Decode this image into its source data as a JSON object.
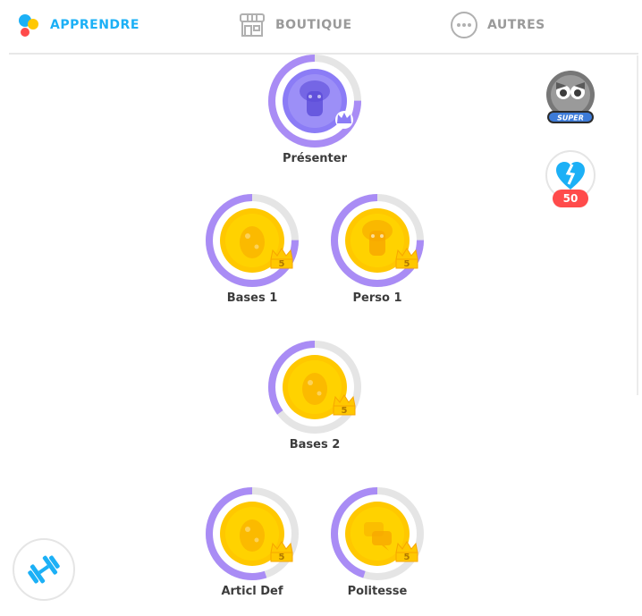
{
  "nav": {
    "learn_label": "APPRENDRE",
    "shop_label": "BOUTIQUE",
    "more_label": "AUTRES",
    "active_color": "#1cb0f6",
    "inactive_color": "#9a9a9a"
  },
  "super_badge": {
    "label": "SUPER"
  },
  "health": {
    "count": "50"
  },
  "skills": [
    {
      "name": "Présenter",
      "crown": "",
      "progress": 0.75,
      "icon": "bust-icon",
      "color": "purple"
    },
    {
      "name": "Bases 1",
      "crown": "5",
      "progress": 0.75,
      "icon": "egg-icon",
      "color": "gold"
    },
    {
      "name": "Perso 1",
      "crown": "5",
      "progress": 0.75,
      "icon": "bust-icon",
      "color": "gold"
    },
    {
      "name": "Bases 2",
      "crown": "5",
      "progress": 0.35,
      "icon": "egg-icon",
      "color": "gold"
    },
    {
      "name": "Articl Def",
      "crown": "5",
      "progress": 0.55,
      "icon": "egg-icon",
      "color": "gold"
    },
    {
      "name": "Politesse",
      "crown": "5",
      "progress": 0.45,
      "icon": "speech-bubbles-icon",
      "color": "gold"
    }
  ],
  "colors": {
    "progress_ring": "#a98cf5",
    "ring_track": "#e5e5e5",
    "gold": "#ffc800",
    "gold_dark": "#f7a600",
    "purple": "#8b7cf6"
  }
}
